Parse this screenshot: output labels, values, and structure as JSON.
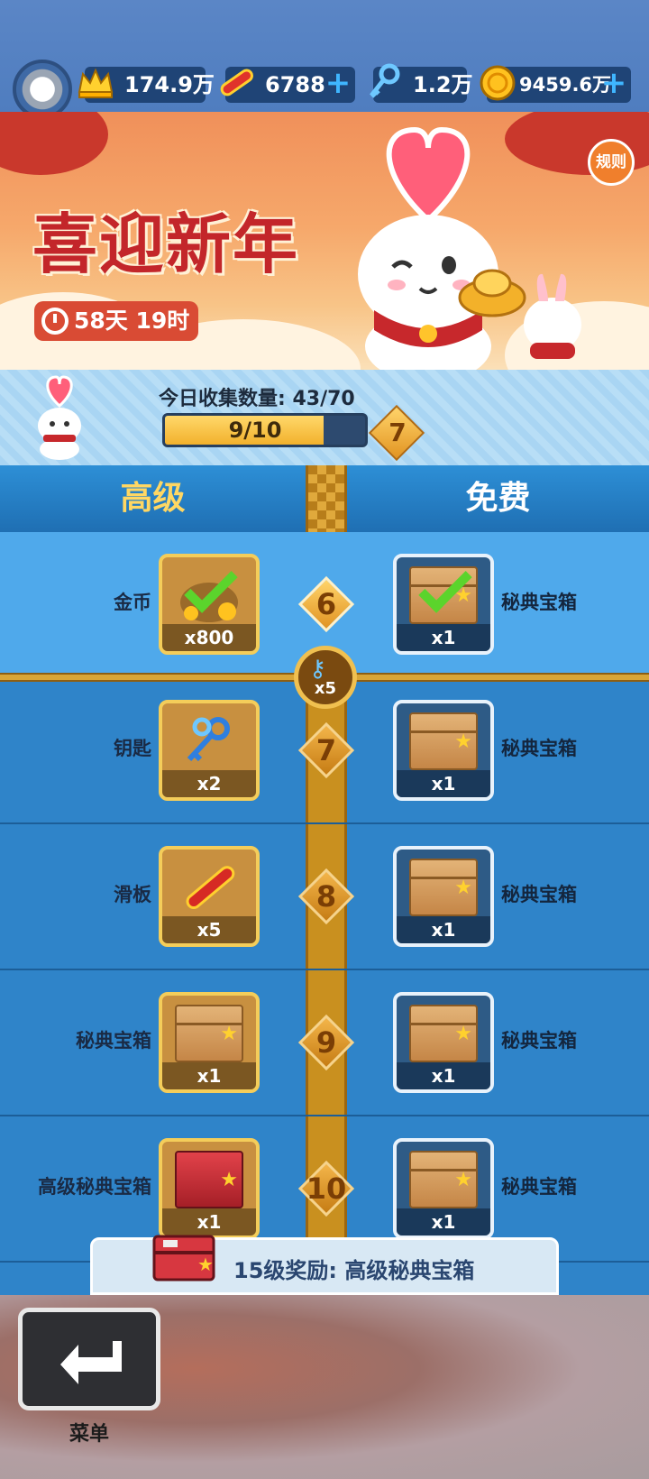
{
  "resources": {
    "crown": "174.9万",
    "skateboard": "6788",
    "keys": "1.2万",
    "coins": "9459.6万"
  },
  "banner": {
    "title": "喜迎新年",
    "timer": "58天 19时",
    "rules_label": "规则"
  },
  "collection": {
    "label": "今日收集数量: 43/70",
    "progress_text": "9/10",
    "progress_fraction": 0.9,
    "current_level": "7"
  },
  "columns": {
    "premium": "高级",
    "free": "免费"
  },
  "rows": [
    {
      "level": "6",
      "premium_label": "金币",
      "premium_qty": "x800",
      "premium_icon": "coin-bag-icon",
      "free_label": "秘典宝箱",
      "free_qty": "x1",
      "claimed": true
    },
    {
      "level": "7",
      "premium_label": "钥匙",
      "premium_qty": "x2",
      "premium_icon": "keys-icon",
      "free_label": "秘典宝箱",
      "free_qty": "x1",
      "claimed": false
    },
    {
      "level": "8",
      "premium_label": "滑板",
      "premium_qty": "x5",
      "premium_icon": "skateboard-icon",
      "free_label": "秘典宝箱",
      "free_qty": "x1",
      "claimed": false
    },
    {
      "level": "9",
      "premium_label": "秘典宝箱",
      "premium_qty": "x1",
      "premium_icon": "box-icon",
      "free_label": "秘典宝箱",
      "free_qty": "x1",
      "claimed": false
    },
    {
      "level": "10",
      "premium_label": "高级秘典宝箱",
      "premium_qty": "x1",
      "premium_icon": "red-chest-icon",
      "free_label": "秘典宝箱",
      "free_qty": "x1",
      "claimed": false
    }
  ],
  "key_marker_qty": "x5",
  "reward_bar": "15级奖励: 高级秘典宝箱",
  "menu_label": "菜单",
  "colors": {
    "accent_gold": "#f4cd5a",
    "track_blue": "#2f84c9",
    "claimed_row": "#4fa9eb"
  }
}
